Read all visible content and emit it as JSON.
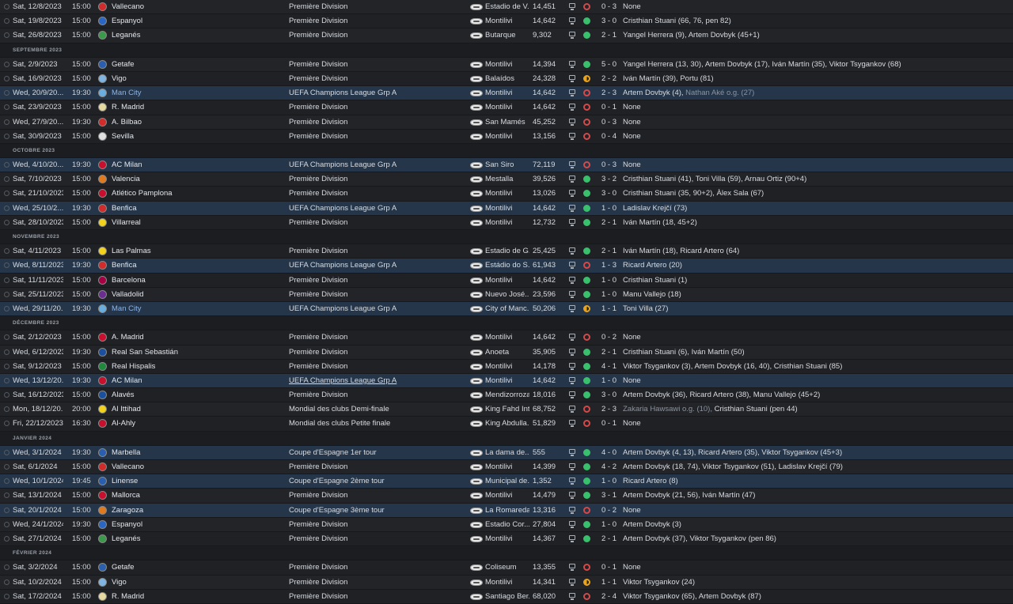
{
  "rows": [
    {
      "kind": "match",
      "date": "Sat, 12/8/2023",
      "time": "15:00",
      "opponent": "Vallecano",
      "competition": "Première Division",
      "venue": "Estadio de V...",
      "attendance": "14,451",
      "result": "L",
      "score": "0 - 3",
      "scorers": "None",
      "crest_color": "#d12b2b"
    },
    {
      "kind": "match",
      "date": "Sat, 19/8/2023",
      "time": "15:00",
      "opponent": "Espanyol",
      "competition": "Première Division",
      "venue": "Montilivi",
      "attendance": "14,642",
      "result": "W",
      "score": "3 - 0",
      "scorers": "Cristhian Stuani (66, 76, pen 82)",
      "crest_color": "#2a66c4"
    },
    {
      "kind": "match",
      "date": "Sat, 26/8/2023",
      "time": "15:00",
      "opponent": "Leganés",
      "competition": "Première Division",
      "venue": "Butarque",
      "attendance": "9,302",
      "result": "W",
      "score": "2 - 1",
      "scorers": "Yangel Herrera (9), Artem Dovbyk (45+1)",
      "crest_color": "#3a9a4a"
    },
    {
      "kind": "month",
      "label": "SEPTEMBRE 2023"
    },
    {
      "kind": "match",
      "date": "Sat, 2/9/2023",
      "time": "15:00",
      "opponent": "Getafe",
      "competition": "Première Division",
      "venue": "Montilivi",
      "attendance": "14,394",
      "result": "W",
      "score": "5 - 0",
      "scorers": "Yangel Herrera (13, 30), Artem Dovbyk (17), Iván Martín (35), Viktor Tsygankov (68)",
      "crest_color": "#2a5fb0"
    },
    {
      "kind": "match",
      "date": "Sat, 16/9/2023",
      "time": "15:00",
      "opponent": "Vigo",
      "competition": "Première Division",
      "venue": "Balaídos",
      "attendance": "24,328",
      "result": "D",
      "score": "2 - 2",
      "scorers": "Iván Martín (39), Portu (81)",
      "crest_color": "#7fb3e0"
    },
    {
      "kind": "match",
      "euro": true,
      "date": "Wed, 20/9/20...",
      "time": "19:30",
      "opponent": "Man City",
      "opp_mc": true,
      "competition": "UEFA Champions League Grp A",
      "venue": "Montilivi",
      "attendance": "14,642",
      "result": "L",
      "score": "2 - 3",
      "scorers": "Artem Dovbyk (4),",
      "og": " Nathan Aké o.g. (27)",
      "crest_color": "#6aaee0"
    },
    {
      "kind": "match",
      "date": "Sat, 23/9/2023",
      "time": "15:00",
      "opponent": "R. Madrid",
      "competition": "Première Division",
      "venue": "Montilivi",
      "attendance": "14,642",
      "result": "L",
      "score": "0 - 1",
      "scorers": "None",
      "crest_color": "#e6d9a0"
    },
    {
      "kind": "match",
      "date": "Wed, 27/9/20...",
      "time": "19:30",
      "opponent": "A. Bilbao",
      "competition": "Première Division",
      "venue": "San Mamés",
      "attendance": "45,252",
      "result": "L",
      "score": "0 - 3",
      "scorers": "None",
      "crest_color": "#d12b2b"
    },
    {
      "kind": "match",
      "date": "Sat, 30/9/2023",
      "time": "15:00",
      "opponent": "Sevilla",
      "competition": "Première Division",
      "venue": "Montilivi",
      "attendance": "13,156",
      "result": "L",
      "score": "0 - 4",
      "scorers": "None",
      "crest_color": "#e0e0e0"
    },
    {
      "kind": "month",
      "label": "OCTOBRE 2023"
    },
    {
      "kind": "match",
      "euro": true,
      "date": "Wed, 4/10/20...",
      "time": "19:30",
      "opponent": "AC Milan",
      "competition": "UEFA Champions League Grp A",
      "venue": "San Siro",
      "attendance": "72,119",
      "result": "L",
      "score": "0 - 3",
      "scorers": "None",
      "crest_color": "#c8102e"
    },
    {
      "kind": "match",
      "date": "Sat, 7/10/2023",
      "time": "15:00",
      "opponent": "Valencia",
      "competition": "Première Division",
      "venue": "Mestalla",
      "attendance": "39,526",
      "result": "W",
      "score": "3 - 2",
      "scorers": "Cristhian Stuani (41), Toni Villa (59), Arnau Ortiz (90+4)",
      "crest_color": "#e07a1e"
    },
    {
      "kind": "match",
      "date": "Sat, 21/10/2023",
      "time": "15:00",
      "opponent": "Atlético Pamplona",
      "competition": "Première Division",
      "venue": "Montilivi",
      "attendance": "13,026",
      "result": "W",
      "score": "3 - 0",
      "scorers": "Cristhian Stuani (35, 90+2), Àlex Sala (67)",
      "crest_color": "#c8102e"
    },
    {
      "kind": "match",
      "euro": true,
      "date": "Wed, 25/10/2...",
      "time": "19:30",
      "opponent": "Benfica",
      "competition": "UEFA Champions League Grp A",
      "venue": "Montilivi",
      "attendance": "14,642",
      "result": "W",
      "score": "1 - 0",
      "scorers": "Ladislav Krejčí (73)",
      "crest_color": "#d12b2b"
    },
    {
      "kind": "match",
      "date": "Sat, 28/10/2023",
      "time": "15:00",
      "opponent": "Villarreal",
      "competition": "Première Division",
      "venue": "Montilivi",
      "attendance": "12,732",
      "result": "W",
      "score": "2 - 1",
      "scorers": "Iván Martín (18, 45+2)",
      "crest_color": "#f2d21a"
    },
    {
      "kind": "month",
      "label": "NOVEMBRE 2023"
    },
    {
      "kind": "match",
      "date": "Sat, 4/11/2023",
      "time": "15:00",
      "opponent": "Las Palmas",
      "competition": "Première Division",
      "venue": "Estadio de G...",
      "attendance": "25,425",
      "result": "W",
      "score": "2 - 1",
      "scorers": "Iván Martín (18), Ricard Artero (64)",
      "crest_color": "#f2d21a"
    },
    {
      "kind": "match",
      "euro": true,
      "date": "Wed, 8/11/2023",
      "time": "19:30",
      "opponent": "Benfica",
      "competition": "UEFA Champions League Grp A",
      "venue": "Estádio do S...",
      "attendance": "61,943",
      "result": "L",
      "score": "1 - 3",
      "scorers": "Ricard Artero (20)",
      "crest_color": "#d12b2b"
    },
    {
      "kind": "match",
      "date": "Sat, 11/11/2023",
      "time": "15:00",
      "opponent": "Barcelona",
      "competition": "Première Division",
      "venue": "Montilivi",
      "attendance": "14,642",
      "result": "W",
      "score": "1 - 0",
      "scorers": "Cristhian Stuani (1)",
      "crest_color": "#a50044"
    },
    {
      "kind": "match",
      "date": "Sat, 25/11/2023",
      "time": "15:00",
      "opponent": "Valladolid",
      "competition": "Première Division",
      "venue": "Nuevo José...",
      "attendance": "23,596",
      "result": "W",
      "score": "1 - 0",
      "scorers": "Manu Vallejo (18)",
      "crest_color": "#6b2d8f"
    },
    {
      "kind": "match",
      "euro": true,
      "date": "Wed, 29/11/20...",
      "time": "19:30",
      "opponent": "Man City",
      "opp_mc": true,
      "competition": "UEFA Champions League Grp A",
      "venue": "City of Manc...",
      "attendance": "50,206",
      "result": "D",
      "score": "1 - 1",
      "scorers": "Toni Villa (27)",
      "crest_color": "#6aaee0"
    },
    {
      "kind": "month",
      "label": "DÉCEMBRE 2023"
    },
    {
      "kind": "match",
      "date": "Sat, 2/12/2023",
      "time": "15:00",
      "opponent": "A. Madrid",
      "competition": "Première Division",
      "venue": "Montilivi",
      "attendance": "14,642",
      "result": "L",
      "score": "0 - 2",
      "scorers": "None",
      "crest_color": "#c8102e"
    },
    {
      "kind": "match",
      "date": "Wed, 6/12/2023",
      "time": "19:30",
      "opponent": "Real San Sebastián",
      "competition": "Première Division",
      "venue": "Anoeta",
      "attendance": "35,905",
      "result": "W",
      "score": "2 - 1",
      "scorers": "Cristhian Stuani (6), Iván Martín (50)",
      "crest_color": "#1b4fa0"
    },
    {
      "kind": "match",
      "date": "Sat, 9/12/2023",
      "time": "15:00",
      "opponent": "Real Hispalis",
      "competition": "Première Division",
      "venue": "Montilivi",
      "attendance": "14,178",
      "result": "W",
      "score": "4 - 1",
      "scorers": "Viktor Tsygankov (3), Artem Dovbyk (16, 40), Cristhian Stuani (85)",
      "crest_color": "#1e8a3c"
    },
    {
      "kind": "match",
      "euro": true,
      "date": "Wed, 13/12/20...",
      "time": "19:30",
      "opponent": "AC Milan",
      "competition": "UEFA Champions League Grp A",
      "comp_underline": true,
      "venue": "Montilivi",
      "attendance": "14,642",
      "result": "W",
      "score": "1 - 0",
      "scorers": "None",
      "crest_color": "#c8102e"
    },
    {
      "kind": "match",
      "date": "Sat, 16/12/2023",
      "time": "15:00",
      "opponent": "Alavés",
      "competition": "Première Division",
      "venue": "Mendizorroza",
      "attendance": "18,016",
      "result": "W",
      "score": "3 - 0",
      "scorers": "Artem Dovbyk (36), Ricard Artero (38), Manu Vallejo (45+2)",
      "crest_color": "#1b4fa0"
    },
    {
      "kind": "match",
      "date": "Mon, 18/12/20...",
      "time": "20:00",
      "opponent": "Al Ittihad",
      "competition": "Mondial des clubs Demi-finale",
      "venue": "King Fahd Int...",
      "attendance": "68,752",
      "result": "L",
      "score": "2 - 3",
      "scorers": "",
      "og": "Zakaria Hawsawi o.g. (10),",
      "scorers2": " Cristhian Stuani (pen 44)",
      "crest_color": "#f2d21a"
    },
    {
      "kind": "match",
      "date": "Fri, 22/12/2023",
      "time": "16:30",
      "opponent": "Al-Ahly",
      "competition": "Mondial des clubs Petite finale",
      "venue": "King Abdulla...",
      "attendance": "51,829",
      "result": "L",
      "score": "0 - 1",
      "scorers": "None",
      "crest_color": "#c8102e"
    },
    {
      "kind": "month",
      "label": "JANVIER 2024"
    },
    {
      "kind": "match",
      "euro": true,
      "date": "Wed, 3/1/2024",
      "time": "19:30",
      "opponent": "Marbella",
      "competition": "Coupe d'Espagne 1er tour",
      "venue": "La dama de...",
      "attendance": "555",
      "result": "W",
      "score": "4 - 0",
      "scorers": "Artem Dovbyk (4, 13), Ricard Artero (35), Viktor Tsygankov (45+3)",
      "crest_color": "#2a5fb0"
    },
    {
      "kind": "match",
      "date": "Sat, 6/1/2024",
      "time": "15:00",
      "opponent": "Vallecano",
      "competition": "Première Division",
      "venue": "Montilivi",
      "attendance": "14,399",
      "result": "W",
      "score": "4 - 2",
      "scorers": "Artem Dovbyk (18, 74), Viktor Tsygankov (51), Ladislav Krejčí (79)",
      "crest_color": "#d12b2b"
    },
    {
      "kind": "match",
      "euro": true,
      "date": "Wed, 10/1/2024",
      "time": "19:45",
      "opponent": "Linense",
      "competition": "Coupe d'Espagne 2ème tour",
      "venue": "Municipal de...",
      "attendance": "1,352",
      "result": "W",
      "score": "1 - 0",
      "scorers": "Ricard Artero (8)",
      "crest_color": "#2a5fb0"
    },
    {
      "kind": "match",
      "date": "Sat, 13/1/2024",
      "time": "15:00",
      "opponent": "Mallorca",
      "competition": "Première Division",
      "venue": "Montilivi",
      "attendance": "14,479",
      "result": "W",
      "score": "3 - 1",
      "scorers": "Artem Dovbyk (21, 56), Iván Martín (47)",
      "crest_color": "#c8102e"
    },
    {
      "kind": "match",
      "euro": true,
      "date": "Sat, 20/1/2024",
      "time": "15:00",
      "opponent": "Zaragoza",
      "competition": "Coupe d'Espagne 3ème tour",
      "venue": "La Romareda",
      "attendance": "13,316",
      "result": "L",
      "score": "0 - 2",
      "scorers": "None",
      "crest_color": "#e07a1e"
    },
    {
      "kind": "match",
      "date": "Wed, 24/1/2024",
      "time": "19:30",
      "opponent": "Espanyol",
      "competition": "Première Division",
      "venue": "Estadio Cor...",
      "attendance": "27,804",
      "result": "W",
      "score": "1 - 0",
      "scorers": "Artem Dovbyk (3)",
      "crest_color": "#2a66c4"
    },
    {
      "kind": "match",
      "date": "Sat, 27/1/2024",
      "time": "15:00",
      "opponent": "Leganés",
      "competition": "Première Division",
      "venue": "Montilivi",
      "attendance": "14,367",
      "result": "W",
      "score": "2 - 1",
      "scorers": "Artem Dovbyk (37), Viktor Tsygankov (pen 86)",
      "crest_color": "#3a9a4a"
    },
    {
      "kind": "month",
      "label": "FÉVRIER 2024"
    },
    {
      "kind": "match",
      "date": "Sat, 3/2/2024",
      "time": "15:00",
      "opponent": "Getafe",
      "competition": "Première Division",
      "venue": "Coliseum",
      "attendance": "13,355",
      "result": "L",
      "score": "0 - 1",
      "scorers": "None",
      "crest_color": "#2a5fb0"
    },
    {
      "kind": "match",
      "date": "Sat, 10/2/2024",
      "time": "15:00",
      "opponent": "Vigo",
      "competition": "Première Division",
      "venue": "Montilivi",
      "attendance": "14,341",
      "result": "D",
      "score": "1 - 1",
      "scorers": "Viktor Tsygankov (24)",
      "crest_color": "#7fb3e0"
    },
    {
      "kind": "match",
      "date": "Sat, 17/2/2024",
      "time": "15:00",
      "opponent": "R. Madrid",
      "competition": "Première Division",
      "venue": "Santiago Ber...",
      "attendance": "68,020",
      "result": "L",
      "score": "2 - 4",
      "scorers": "Viktor Tsygankov (65), Artem Dovbyk (87)",
      "crest_color": "#e6d9a0"
    }
  ]
}
